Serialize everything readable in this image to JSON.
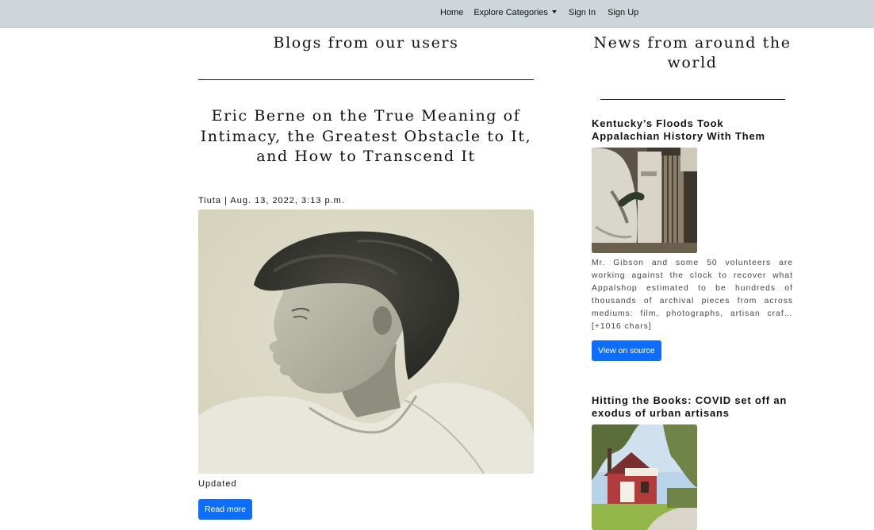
{
  "nav": {
    "home": "Home",
    "explore": "Explore Categories",
    "sign_in": "Sign In",
    "sign_up": "Sign Up"
  },
  "blogs": {
    "heading": "Blogs from our users",
    "post": {
      "title": "Eric Berne on the True Meaning of Intimacy, the Greatest Obstacle to It, and How to Transcend It",
      "meta": "Tiuta | Aug. 13, 2022, 3:13 p.m.",
      "status": "Updated",
      "read_more": "Read more"
    }
  },
  "news": {
    "heading": "News from around the world",
    "items": [
      {
        "title": "Kentucky’s Floods Took Appalachian History With Them",
        "description": "Mr. Gibson and some 50 volunteers are working against the clock to recover what Appalshop estimated to be hundreds of thousands of archival pieces from across mediums: film, photographs, artisan craf… [+1016 chars]",
        "button": "View on source"
      },
      {
        "title": "Hitting the Books: COVID set off an exodus of urban artisans"
      }
    ]
  },
  "colors": {
    "navbar_bg": "#cfd6d9",
    "button_primary": "#0d6efd"
  }
}
